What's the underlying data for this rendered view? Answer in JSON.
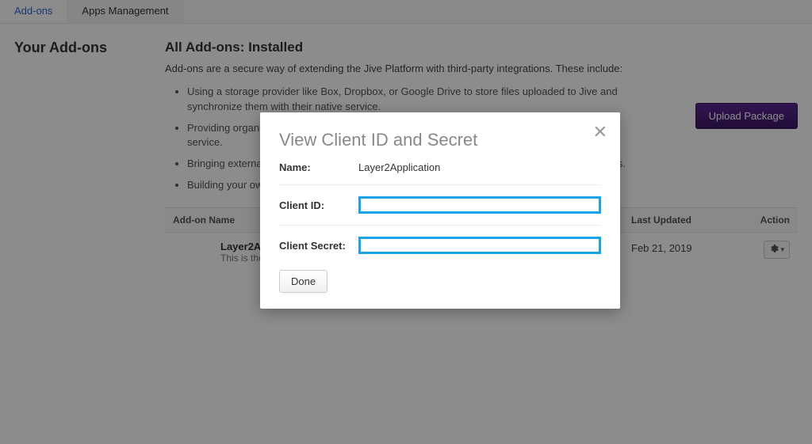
{
  "tabs": {
    "addons": "Add-ons",
    "apps": "Apps Management"
  },
  "sidebar": {
    "title": "Your Add-ons"
  },
  "page": {
    "heading": "All Add-ons: Installed",
    "intro": "Add-ons are a secure way of extending the Jive Platform with third-party integrations. These include:",
    "bullets": [
      "Using a storage provider like Box, Dropbox, or Google Drive to store files uploaded to Jive and synchronize them with their native service.",
      "Providing organizations with easy integration with customer relationship and sales analytics service.",
      "Bringing external event streams into Jive and exposing new endpoints that extend the Jive APIs.",
      "Building your own re-usable integrations on top of Jive."
    ]
  },
  "upload_btn": "Upload Package",
  "table": {
    "head": {
      "name": "Add-on Name",
      "updated": "Last Updated",
      "action": "Action"
    },
    "row": {
      "title": "Layer2Application",
      "sub": "This is the add-on for Layer2Application.",
      "updated": "Feb 21, 2019"
    }
  },
  "modal": {
    "title": "View Client ID and Secret",
    "name_label": "Name:",
    "name_value": "Layer2Application",
    "client_id_label": "Client ID:",
    "client_secret_label": "Client Secret:",
    "done": "Done"
  }
}
